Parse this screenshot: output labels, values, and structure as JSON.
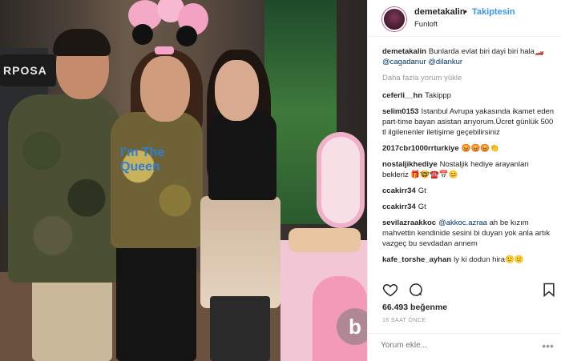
{
  "photo": {
    "sign_text": "RPOSA",
    "watermark_icon": "b-logo-watermark",
    "shirt_text": "I'm The Queen"
  },
  "post": {
    "username": "demetakalin",
    "dot": "•",
    "follow_label": "Takiptesin",
    "location": "Funloft",
    "caption_user": "demetakalin",
    "caption_text": "Bunlarda evlat biri dayi biri hala🏎️ ",
    "caption_mention1": "@cagadanur",
    "caption_mention2": "@dilankur",
    "load_more": "Daha fazla yorum yükle",
    "comments": [
      {
        "user": "ceferli__hn",
        "text": "Takippp"
      },
      {
        "user": "selim0153",
        "text": "Istanbul Avrupa yakasında ikamet eden part-time bayan asistan arıyorum.Ücret günlük 500 tl ilgilenenler iletişime geçebilirsiniz"
      },
      {
        "user": "2017cbr1000rrturkiye",
        "text": "😡😡😡👏"
      },
      {
        "user": "nostaljikhediye",
        "text": "Nostaljik hediye arayanları bekleriz 🎁🤓☎️📅😊"
      },
      {
        "user": "ccakirr34",
        "text": "Gt"
      },
      {
        "user": "ccakirr34",
        "text": "Gt"
      },
      {
        "user": "sevilazraakkoc",
        "text": "ah be kızım mahvettin kendinide sesini bi duyan yok anla artık vazgeç bu sevdadan annem",
        "mention": "@akkoc.azraa"
      },
      {
        "user": "kafe_torshe_ayhan",
        "text": "ly ki dodun hira🙂🙂"
      }
    ],
    "icons": {
      "like": "heart-icon",
      "comment": "comment-icon",
      "save": "bookmark-icon"
    },
    "likes": "66.493 beğenme",
    "time": "16 SAAT ÖNCE",
    "add_comment_placeholder": "Yorum ekle...",
    "more_dots": "•••"
  }
}
